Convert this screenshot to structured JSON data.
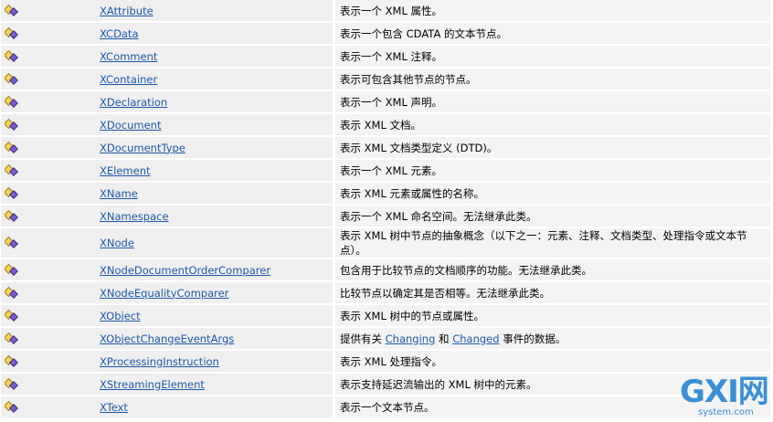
{
  "rows": [
    {
      "name": "XAttribute",
      "desc": "表示一个 XML 属性。"
    },
    {
      "name": "XCData",
      "desc": "表示一个包含 CDATA 的文本节点。"
    },
    {
      "name": "XComment",
      "desc": "表示一个 XML 注释。"
    },
    {
      "name": "XContainer",
      "desc": "表示可包含其他节点的节点。"
    },
    {
      "name": "XDeclaration",
      "desc": "表示一个 XML 声明。"
    },
    {
      "name": "XDocument",
      "desc": "表示 XML 文档。"
    },
    {
      "name": "XDocumentType",
      "desc": "表示 XML 文档类型定义 (DTD)。"
    },
    {
      "name": "XElement",
      "desc": "表示一个 XML 元素。"
    },
    {
      "name": "XName",
      "desc": "表示 XML 元素或属性的名称。"
    },
    {
      "name": "XNamespace",
      "desc": "表示一个 XML 命名空间。无法继承此类。"
    },
    {
      "name": "XNode",
      "desc": "表示 XML 树中节点的抽象概念（以下之一：元素、注释、文档类型、处理指令或文本节点）。"
    },
    {
      "name": "XNodeDocumentOrderComparer",
      "desc": "包含用于比较节点的文档顺序的功能。无法继承此类。"
    },
    {
      "name": "XNodeEqualityComparer",
      "desc": "比较节点以确定其是否相等。无法继承此类。"
    },
    {
      "name": "XObject",
      "desc": "表示 XML 树中的节点或属性。"
    },
    {
      "name": "XObjectChangeEventArgs",
      "desc_pre": "提供有关 ",
      "link1": "Changing",
      "desc_mid": " 和 ",
      "link2": "Changed",
      "desc_post": " 事件的数据。"
    },
    {
      "name": "XProcessingInstruction",
      "desc": "表示 XML 处理指令。"
    },
    {
      "name": "XStreamingElement",
      "desc": "表示支持延迟流输出的 XML 树中的元素。"
    },
    {
      "name": "XText",
      "desc": "表示一个文本节点。"
    }
  ],
  "watermark": {
    "big": "GXI网",
    "sub": "system.com"
  },
  "colors": {
    "link": "#1c5aa8",
    "row_bg": "#efefef",
    "watermark": "#3a8fd6"
  }
}
